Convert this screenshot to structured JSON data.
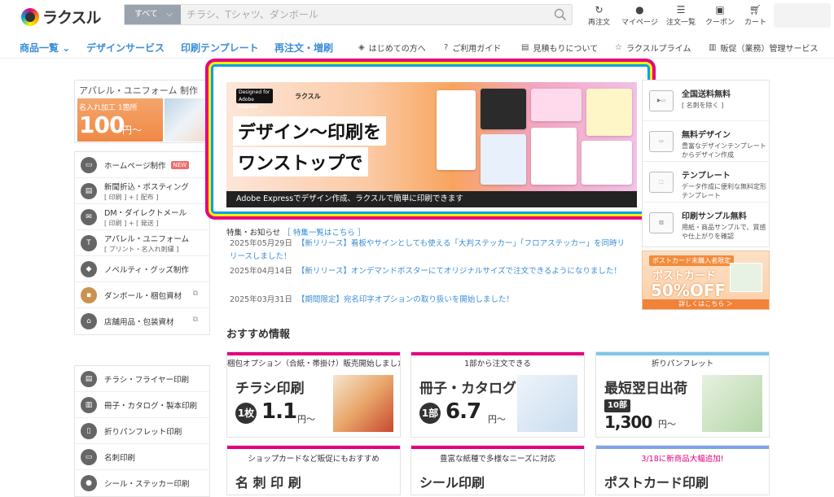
{
  "header": {
    "logo_text": "ラクスル",
    "search": {
      "category": "すべて",
      "placeholder": "チラシ、Tシャツ、ダンボール"
    },
    "nav": [
      {
        "label": "再注文",
        "icon": "reorder-icon"
      },
      {
        "label": "マイページ",
        "icon": "user-icon"
      },
      {
        "label": "注文一覧",
        "icon": "list-icon"
      },
      {
        "label": "クーポン",
        "icon": "coupon-icon"
      },
      {
        "label": "カート",
        "icon": "cart-icon"
      }
    ]
  },
  "global_nav": {
    "main": [
      "商品一覧",
      "デザインサービス",
      "印刷テンプレート",
      "再注文・増刷"
    ],
    "sub": [
      "はじめての方へ",
      "ご利用ガイド",
      "見積もりについて",
      "ラクスルプライム",
      "販促（業務）管理サービス"
    ]
  },
  "left_promo": {
    "title": "アパレル・ユニフォーム 制作",
    "label": "名入れ加工 1箇所",
    "price": "100",
    "unit": "円〜"
  },
  "categories": [
    {
      "label": "ホームページ制作",
      "badge": "NEW"
    },
    {
      "label": "新聞折込・ポスティング",
      "sub": "[ 印刷 ] + [ 配布 ]"
    },
    {
      "label": "DM・ダイレクトメール",
      "sub": "[ 印刷 ] + [ 発送 ]"
    },
    {
      "label": "アパレル・ユニフォーム",
      "sub": "[ プリント・名入れ刺繍 ]"
    },
    {
      "label": "ノベルティ・グッズ制作"
    },
    {
      "label": "ダンボール・梱包資材"
    },
    {
      "label": "店舗用品・包装資材"
    }
  ],
  "categories2": [
    "チラシ・フライヤー印刷",
    "冊子・カタログ・製本印刷",
    "折りパンフレット印刷",
    "名刺印刷",
    "シール・ステッカー印刷"
  ],
  "banner": {
    "badge1": "Designed for Adobe Express",
    "badge2": "ラクスル",
    "line1": "デザイン～印刷を",
    "line2": "ワンストップで",
    "footer": "Adobe Expressでデザイン作成、ラクスルで簡単に印刷できます"
  },
  "news": {
    "title": "特集・お知らせ",
    "link": "［ 特集一覧はこちら ］",
    "items": [
      {
        "date": "2025年05月29日",
        "text": "【新リリース】看板やサインとしても使える「大判ステッカー」「フロアステッカー」を同時リリースしました！"
      },
      {
        "date": "2025年04月14日",
        "text": "【新リリース】オンデマンドポスターにてオリジナルサイズで注文できるようになりました！"
      },
      {
        "date": "2025年03月31日",
        "text": "【期間限定】宛名印字オプションの取り扱いを開始しました！"
      }
    ]
  },
  "recommend": {
    "title": "おすすめ情報",
    "cards": [
      {
        "caption": "梱包オプション（合紙・帯掛け）販売開始しました！",
        "name": "チラシ印刷",
        "qty": "1枚",
        "price": "1.1",
        "unit": "円〜",
        "color": "#e4007f"
      },
      {
        "caption": "1部から注文できる",
        "name": "冊子・カタログ",
        "qty": "1部",
        "price": "6.7",
        "unit": "円〜",
        "color": "#e4007f"
      },
      {
        "caption": "折りパンフレット",
        "name": "最短翌日出荷",
        "qty": "10部",
        "price": "1,300",
        "unit": "円〜",
        "color": "#7ec6e6"
      }
    ],
    "cards2": [
      {
        "caption": "ショップカードなど販促にもおすすめ",
        "name": "名 刺 印 刷",
        "color": "#e4007f"
      },
      {
        "caption": "豊富な紙種で多様なニーズに対応",
        "name": "シール印刷",
        "color": "#e4007f"
      },
      {
        "caption": "3/18に新商品大幅追加!",
        "name": "ポストカード印刷",
        "color": "#7ea5e6"
      }
    ]
  },
  "right": {
    "items": [
      {
        "title": "全国送料無料",
        "desc": "[ 名刺を除く ]"
      },
      {
        "title": "無料デザイン",
        "desc": "豊富なデザインテンプレートからデザイン作成"
      },
      {
        "title": "テンプレート",
        "desc": "データ作成に便利な無料定形テンプレート"
      },
      {
        "title": "印刷サンプル無料",
        "desc": "用紙・商品サンプルで、質感や仕上がりを確認"
      }
    ],
    "promo": {
      "tag": "ポストカード未購入者限定",
      "title": "ポストカード",
      "off": "50%OFF",
      "cta": "詳しくはこちら ＞"
    }
  }
}
